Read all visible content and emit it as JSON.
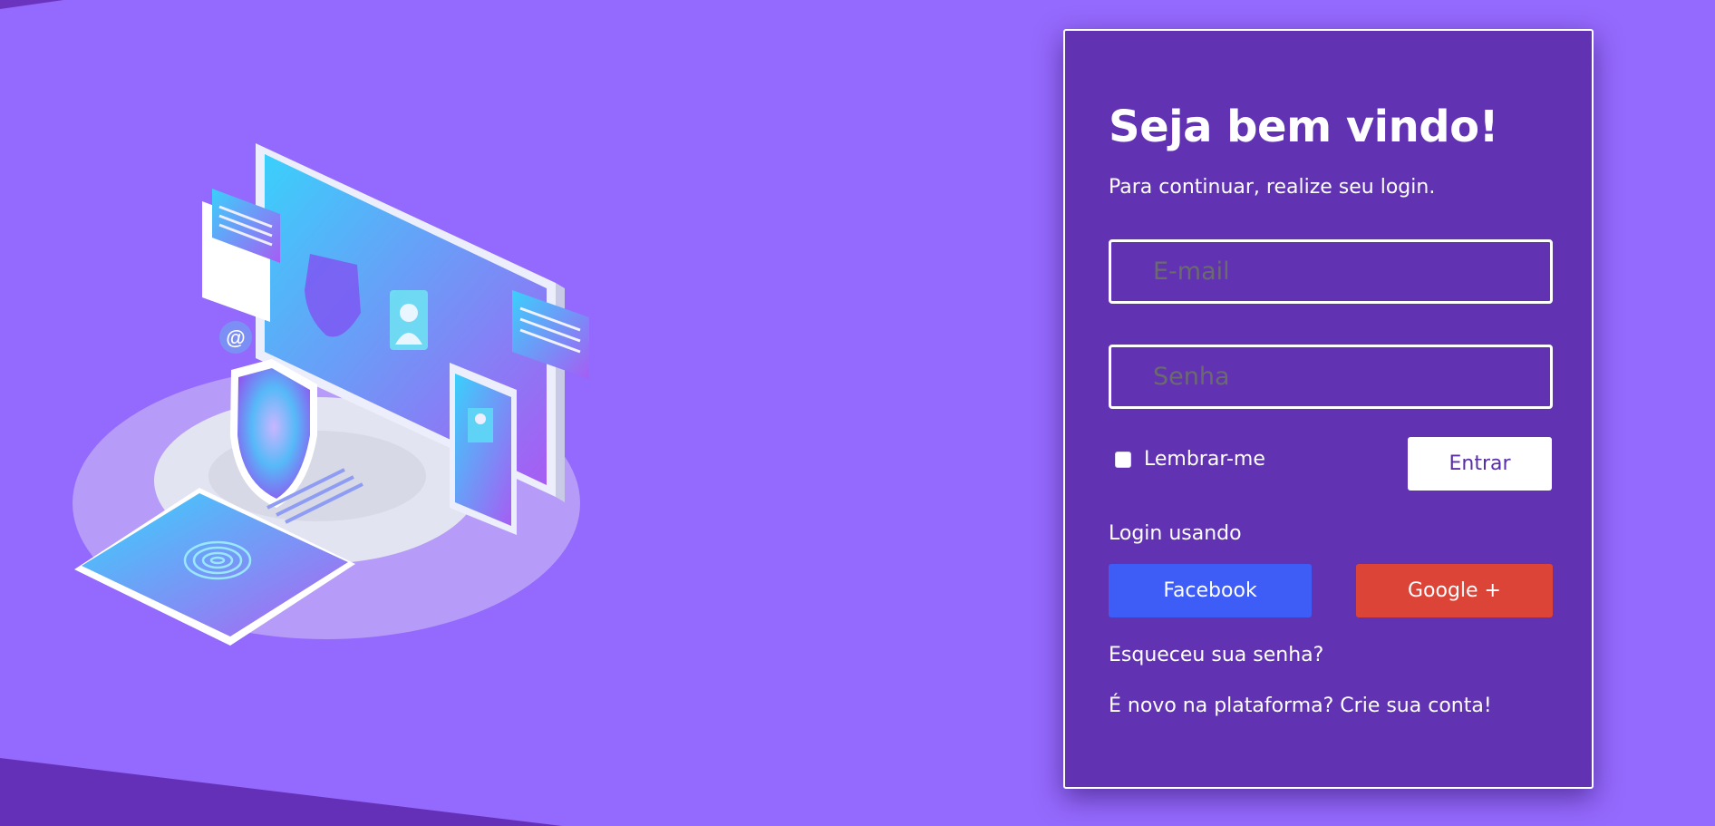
{
  "login": {
    "title": "Seja bem vindo!",
    "subtitle": "Para continuar, realize seu login.",
    "email_placeholder": "E-mail",
    "password_placeholder": "Senha",
    "remember_label": "Lembrar-me",
    "submit_label": "Entrar",
    "login_using_label": "Login usando",
    "facebook_label": "Facebook",
    "google_label": "Google +",
    "forgot_password_link": "Esqueceu sua senha?",
    "signup_link": "É novo na plataforma? Crie sua conta!"
  },
  "colors": {
    "background": "#9469fd",
    "panel": "#6133b3",
    "facebook": "#3e5cf6",
    "google": "#dc4437"
  },
  "icons": [
    "security-illustration",
    "fingerprint-icon",
    "shield-icon",
    "email-at-icon",
    "user-icon"
  ]
}
